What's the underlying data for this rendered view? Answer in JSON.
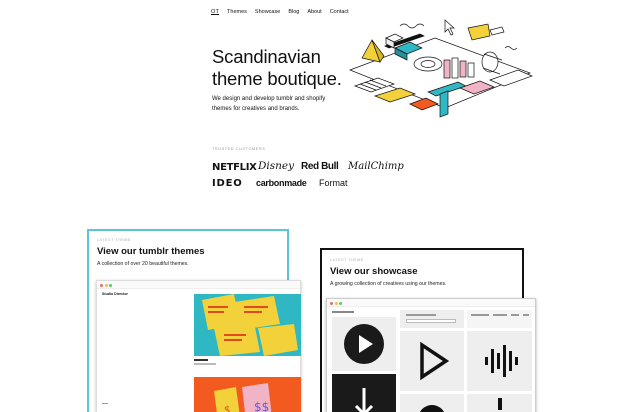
{
  "nav": {
    "logo": "OT",
    "items": [
      "Themes",
      "Showcase",
      "Blog",
      "About",
      "Contact"
    ]
  },
  "hero": {
    "title_line1": "Scandinavian",
    "title_line2": "theme boutique.",
    "subtitle": "We design and develop tumblr and shopify themes for creatives and brands."
  },
  "trusted": {
    "label": "Trusted customers",
    "brands": [
      "NETFLIX",
      "Disney",
      "Red Bull",
      "MailChimp",
      "IDEO",
      "carbonmade",
      "Format"
    ]
  },
  "tumblr_card": {
    "label": "Latest theme",
    "title": "View our tumblr themes",
    "description": "A collection of over 20 beautiful themes.",
    "preview": {
      "site_name": "Studio Director"
    }
  },
  "showcase_card": {
    "label": "Latest theme",
    "title": "View our showcase",
    "description": "A growing collection of creatives using our themes."
  },
  "colors": {
    "accent_blue": "#5bc3dc",
    "dark": "#111111",
    "yellow": "#f2d13a",
    "teal": "#2fb8c4",
    "orange": "#f25a1f",
    "pink": "#f1b3c6"
  }
}
